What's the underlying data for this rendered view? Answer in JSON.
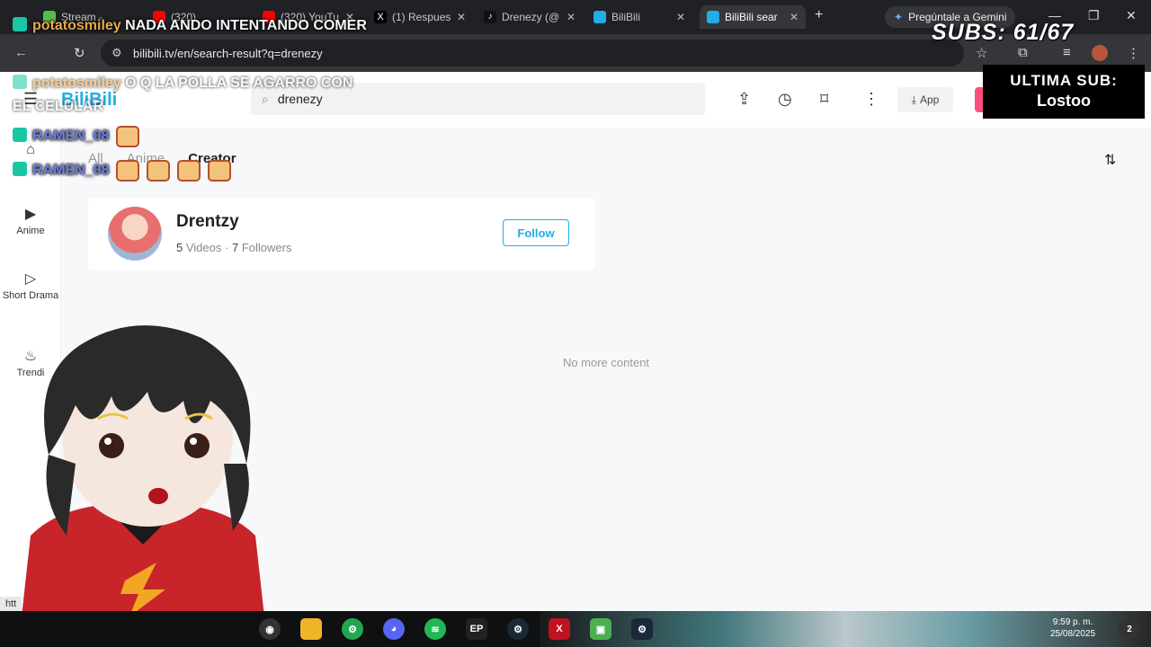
{
  "browser": {
    "tabs": [
      {
        "label": "Stream - "
      },
      {
        "label": "(320) "
      },
      {
        "label": "(320) YouTu"
      },
      {
        "label": "(1) Respues"
      },
      {
        "label": "Drenezy (@"
      },
      {
        "label": "BiliBili"
      },
      {
        "label": "BiliBili sear"
      }
    ],
    "gemini_label": "Pregúntale a Gemini",
    "url": "bilibili.tv/en/search-result?q=drenezy",
    "status_url": "htt"
  },
  "bilibili": {
    "logo_text": "BiliBili",
    "search_value": "drenezy",
    "app_label": "App",
    "sidebar": [
      {
        "label": ""
      },
      {
        "label": "Anime"
      },
      {
        "label": "Short Drama"
      },
      {
        "label": "Trendi"
      }
    ],
    "tabs": [
      "All",
      "Anime",
      "Creator"
    ],
    "creator": {
      "name": "Drentzy",
      "videos_count": "5",
      "videos_label": "Videos",
      "separator": "·",
      "followers_count": "7",
      "followers_label": "Followers",
      "follow_label": "Follow"
    },
    "no_more_content": "No more content"
  },
  "overlay": {
    "chat": [
      {
        "user": "potatosmiley",
        "message": "NADA ANDO INTENTANDO COMER"
      },
      {
        "user": "potatosmiley",
        "message": "O Q LA POLLA SE AGARRO CON EL CELULAR"
      },
      {
        "user": "RAMEN_08",
        "message": ""
      },
      {
        "user": "RAMEN_08",
        "message": ""
      }
    ],
    "subs_label": "SUBS: 61/67",
    "last_sub_title": "ULTIMA SUB:",
    "last_sub_name": "Lostoo"
  },
  "taskbar": {
    "time": "9:59 p. m.",
    "date": "25/08/2025",
    "notification_count": "2"
  },
  "colors": {
    "bilibili_blue": "#23ade5",
    "chat_badge": "#19c7a5",
    "chat_user_orange": "#e9a94a",
    "chat_user_blue": "#6e7fe0"
  }
}
